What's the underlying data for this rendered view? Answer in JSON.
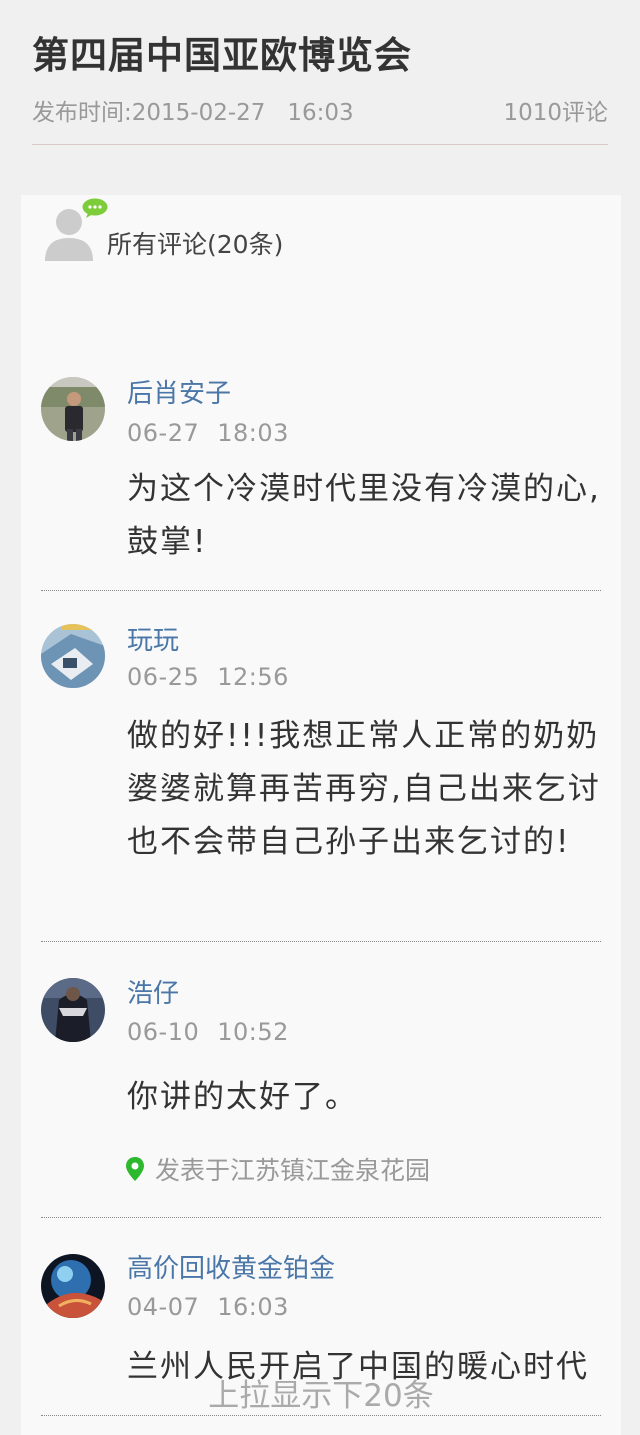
{
  "article": {
    "title": "第四届中国亚欧博览会",
    "publish_label": "发布时间:",
    "publish_date": "2015-02-27",
    "publish_time": "16:03",
    "comment_count": "1010评论"
  },
  "comments_section": {
    "header_label": "所有评论(20条)",
    "load_more": "上拉显示下20条",
    "items": [
      {
        "user": "后肖安子",
        "date": "06-27",
        "time": "18:03",
        "text": "为这个冷漠时代里没有冷漠的心,鼓掌!"
      },
      {
        "user": "玩玩",
        "date": "06-25",
        "time": "12:56",
        "text": "做的好!!!我想正常人正常的奶奶婆婆就算再苦再穷,自己出来乞讨也不会带自己孙子出来乞讨的!"
      },
      {
        "user": "浩仔",
        "date": "06-10",
        "time": "10:52",
        "text": "你讲的太好了。",
        "location": "发表于江苏镇江金泉花园"
      },
      {
        "user": "高价回收黄金铂金",
        "date": "04-07",
        "time": "16:03",
        "text": "兰州人民开启了中国的暖心时代"
      }
    ]
  },
  "colors": {
    "username": "#4a76a8",
    "location_pin": "#2eb82e",
    "bubble": "#7dcc3a"
  }
}
